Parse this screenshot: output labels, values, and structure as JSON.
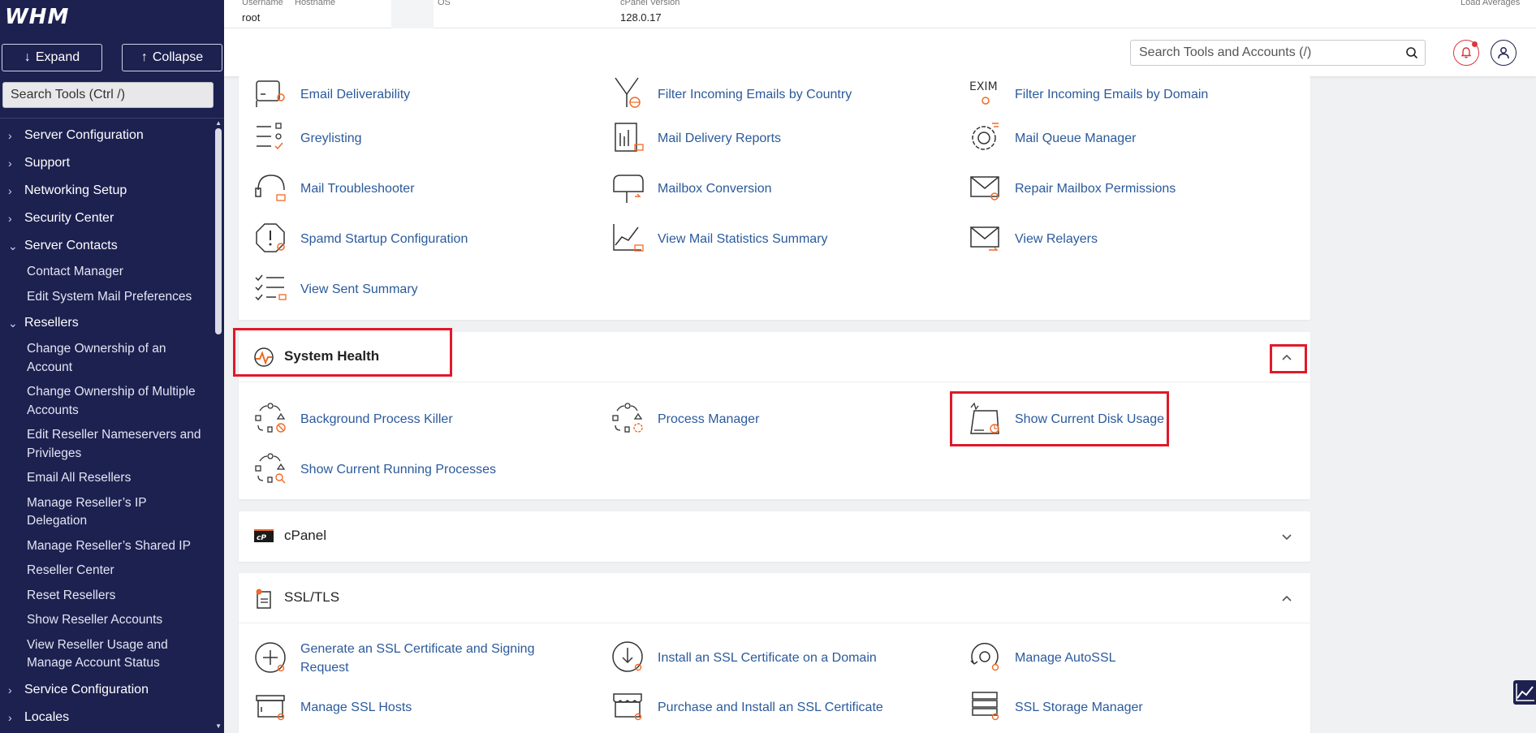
{
  "sidebar": {
    "logo": "WHM",
    "expand_label": "Expand",
    "collapse_label": "Collapse",
    "search_placeholder": "Search Tools (Ctrl /)",
    "items": [
      {
        "label": "Server Configuration",
        "expanded": false
      },
      {
        "label": "Support",
        "expanded": false
      },
      {
        "label": "Networking Setup",
        "expanded": false
      },
      {
        "label": "Security Center",
        "expanded": false
      },
      {
        "label": "Server Contacts",
        "expanded": true
      },
      {
        "label": "Contact Manager"
      },
      {
        "label": "Edit System Mail Preferences"
      },
      {
        "label": "Resellers",
        "expanded": true
      },
      {
        "label": "Change Ownership of an Account"
      },
      {
        "label": "Change Ownership of Multiple Accounts"
      },
      {
        "label": "Edit Reseller Nameservers and Privileges"
      },
      {
        "label": "Email All Resellers"
      },
      {
        "label": "Manage Reseller’s IP Delegation"
      },
      {
        "label": "Manage Reseller’s Shared IP"
      },
      {
        "label": "Reseller Center"
      },
      {
        "label": "Reset Resellers"
      },
      {
        "label": "Show Reseller Accounts"
      },
      {
        "label": "View Reseller Usage and Manage Account Status"
      },
      {
        "label": "Service Configuration",
        "expanded": false
      },
      {
        "label": "Locales",
        "expanded": false
      }
    ]
  },
  "header": {
    "username_label": "Username",
    "username_value": "root",
    "hostname_label": "Hostname",
    "os_label": "OS",
    "cpanel_version_label": "cPanel Version",
    "cpanel_version_value": "128.0.17",
    "load_label": "Load Averages",
    "search_placeholder": "Search Tools and Accounts (/)"
  },
  "email_tools": [
    "Email Deliverability",
    "Filter Incoming Emails by Country",
    "Filter Incoming Emails by Domain",
    "Greylisting",
    "Mail Delivery Reports",
    "Mail Queue Manager",
    "Mail Troubleshooter",
    "Mailbox Conversion",
    "Repair Mailbox Permissions",
    "Spamd Startup Configuration",
    "View Mail Statistics Summary",
    "View Relayers",
    "View Sent Summary"
  ],
  "system_health": {
    "title": "System Health",
    "tools": [
      "Background Process Killer",
      "Process Manager",
      "Show Current Disk Usage",
      "Show Current Running Processes"
    ]
  },
  "cpanel_section": {
    "title": "cPanel",
    "icon_text": "cP"
  },
  "ssl_section": {
    "title": "SSL/TLS",
    "tools": [
      "Generate an SSL Certificate and Signing Request",
      "Install an SSL Certificate on a Domain",
      "Manage AutoSSL",
      "Manage SSL Hosts",
      "Purchase and Install an SSL Certificate",
      "SSL Storage Manager"
    ]
  },
  "colors": {
    "sidebar_bg": "#1d2150",
    "link": "#2b5a9b",
    "accent": "#f06a26",
    "highlight": "#e0192a"
  }
}
